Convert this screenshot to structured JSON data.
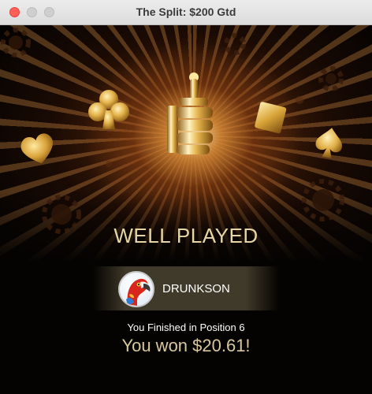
{
  "window": {
    "title": "The Split: $200 Gtd",
    "controls": [
      "close",
      "minimize",
      "maximize"
    ]
  },
  "result": {
    "heading": "WELL PLAYED",
    "player_name": "DRUNKSON",
    "avatar": "parrot-avatar",
    "finish_text": "You Finished in Position 6",
    "winnings_text": "You won $20.61!"
  },
  "decorations": {
    "icons": [
      "thumbs-up-trophy-icon",
      "club-icon",
      "diamond-icon",
      "heart-icon",
      "spade-icon",
      "poker-chip-icon"
    ]
  },
  "colors": {
    "heading": "#e6d6a6",
    "winnings": "#d9c89e",
    "gold": "#e3b24a",
    "close_button": "#fe5f57"
  }
}
